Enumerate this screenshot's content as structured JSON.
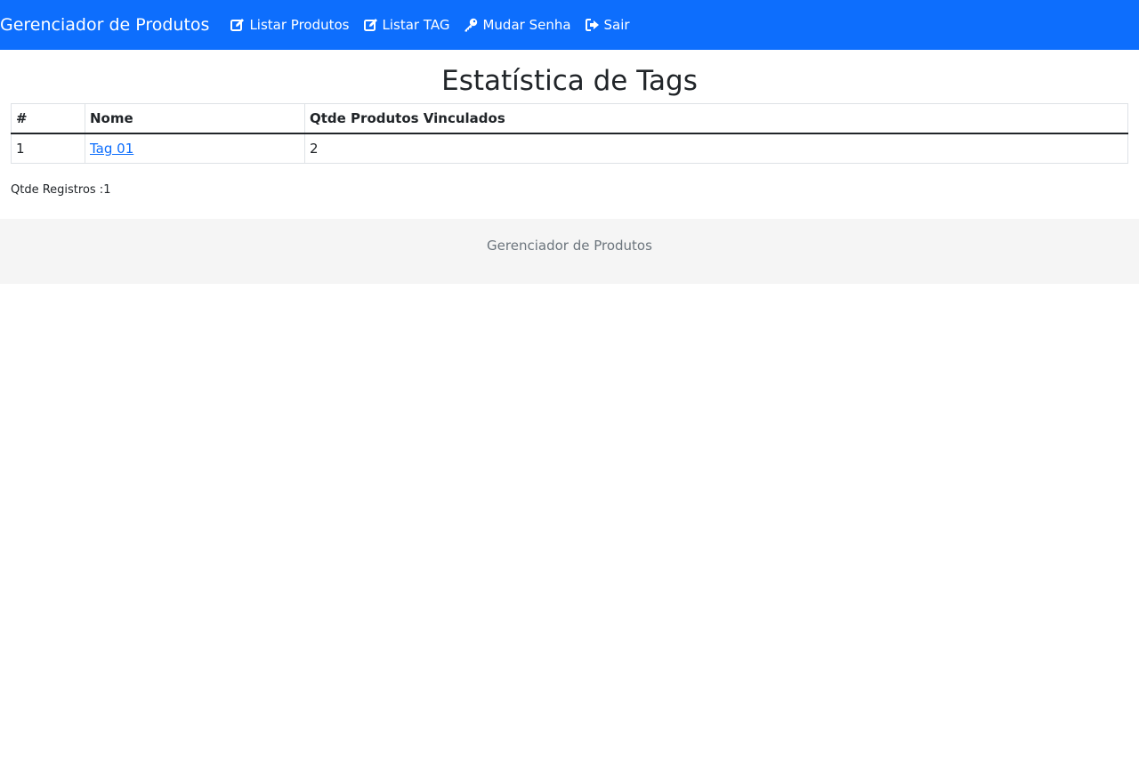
{
  "navbar": {
    "brand": "Gerenciador de Produtos",
    "background": "#0d6efd",
    "links": [
      {
        "label": "Listar Produtos",
        "icon": "edit-icon"
      },
      {
        "label": "Listar TAG",
        "icon": "edit-icon"
      },
      {
        "label": "Mudar Senha",
        "icon": "key-icon"
      },
      {
        "label": "Sair",
        "icon": "sign-out-icon"
      }
    ]
  },
  "main": {
    "title": "Estatística de Tags",
    "table": {
      "headers": [
        "#",
        "Nome",
        "Qtde Produtos Vinculados"
      ],
      "rows": [
        {
          "id": "1",
          "name": "Tag 01",
          "count": "2"
        }
      ]
    },
    "records_label": "Qtde Registros :",
    "records_value": "1"
  },
  "footer": {
    "text": "Gerenciador de Produtos"
  }
}
